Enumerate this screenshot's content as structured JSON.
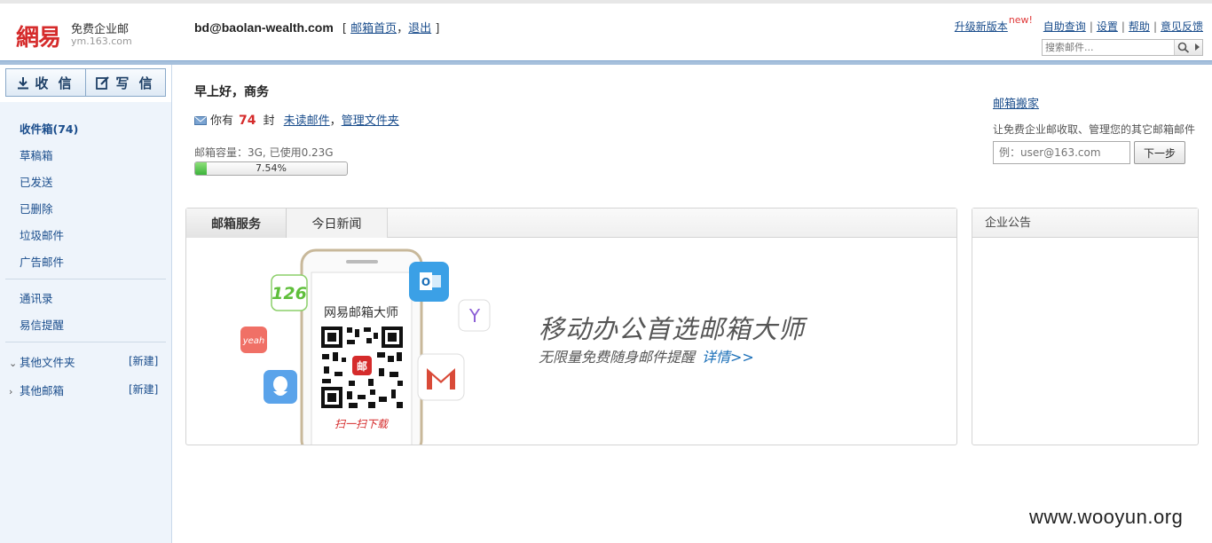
{
  "header": {
    "logo_mark": "網易",
    "logo_name": "免费企业邮",
    "logo_domain": "ym.163.com",
    "account_email": "bd@baolan-wealth.com",
    "account_home": "邮箱首页",
    "account_logout": "退出",
    "top_links": {
      "upgrade": "升级新版本",
      "new_badge": "new!",
      "help_self": "自助查询",
      "settings": "设置",
      "help": "帮助",
      "feedback": "意见反馈"
    },
    "search_placeholder": "搜索邮件..."
  },
  "sidebar": {
    "receive_label": "收 信",
    "compose_label": "写 信",
    "folders": [
      {
        "label": "收件箱(74)"
      },
      {
        "label": "草稿箱"
      },
      {
        "label": "已发送"
      },
      {
        "label": "已删除"
      },
      {
        "label": "垃圾邮件"
      },
      {
        "label": "广告邮件"
      }
    ],
    "tools": [
      {
        "label": "通讯录"
      },
      {
        "label": "易信提醒"
      }
    ],
    "other_folders": "其他文件夹",
    "other_mailboxes": "其他邮箱",
    "new_label": "[新建]"
  },
  "main": {
    "greeting": "早上好，商务",
    "unread_prefix": "你有",
    "unread_count": "74",
    "unread_unit": "封",
    "unread_link": "未读邮件",
    "comma": "，",
    "manage_folders": "管理文件夹",
    "quota_text": "邮箱容量：3G, 已使用0.23G",
    "quota_percent_label": "7.54%",
    "quota_fraction": 0.0754
  },
  "migrate": {
    "title": "邮箱搬家",
    "description": "让免费企业邮收取、管理您的其它邮箱邮件",
    "input_placeholder": "例：user@163.com",
    "next_label": "下一步"
  },
  "service_panel": {
    "tabs": [
      {
        "label": "邮箱服务"
      },
      {
        "label": "今日新闻"
      }
    ],
    "phone_title": "网易邮箱大师",
    "scan_text": "扫一扫下载",
    "app_icons": {
      "n126": "126",
      "yeah": "yeah",
      "y": "Y"
    },
    "promo_title": "移动办公首选邮箱大师",
    "promo_sub": "无限量免费随身邮件提醒",
    "promo_detail": "详情>>"
  },
  "notice_panel": {
    "title": "企业公告"
  },
  "watermark": "www.wooyun.org",
  "colors": {
    "brand_red": "#d52b2b",
    "link_blue": "#1a4d8c",
    "sidebar_bg": "#eef4fb",
    "progress_green": "#3bb33b"
  }
}
